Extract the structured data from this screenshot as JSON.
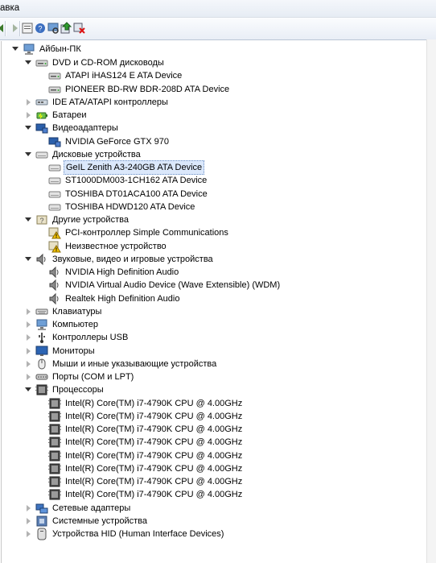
{
  "menubar": {
    "visible_label": "авка"
  },
  "toolbar": {
    "buttons": [
      {
        "name": "back-icon"
      },
      {
        "name": "forward-icon"
      },
      {
        "name": "properties-icon"
      },
      {
        "name": "help-icon"
      },
      {
        "name": "scan-hardware-icon"
      },
      {
        "name": "update-driver-icon"
      },
      {
        "name": "uninstall-icon"
      }
    ]
  },
  "tree": {
    "root": "Айбын-ПК",
    "nodes": [
      {
        "label": "DVD и CD-ROM дисководы",
        "level": 1,
        "state": "open",
        "icon": "dvd-drive-icon"
      },
      {
        "label": "ATAPI iHAS124   E ATA Device",
        "level": 2,
        "icon": "dvd-drive-icon"
      },
      {
        "label": "PIONEER BD-RW   BDR-208D ATA Device",
        "level": 2,
        "icon": "dvd-drive-icon"
      },
      {
        "label": "IDE ATA/ATAPI контроллеры",
        "level": 1,
        "state": "closed",
        "icon": "ide-controller-icon"
      },
      {
        "label": "Батареи",
        "level": 1,
        "state": "closed",
        "icon": "battery-icon"
      },
      {
        "label": "Видеоадаптеры",
        "level": 1,
        "state": "open",
        "icon": "display-adapter-icon"
      },
      {
        "label": "NVIDIA GeForce GTX 970",
        "level": 2,
        "icon": "display-adapter-icon"
      },
      {
        "label": "Дисковые устройства",
        "level": 1,
        "state": "open",
        "icon": "disk-drive-icon"
      },
      {
        "label": "GeIL Zenith A3-240GB ATA Device",
        "level": 2,
        "icon": "disk-drive-icon",
        "selected": true
      },
      {
        "label": "ST1000DM003-1CH162 ATA Device",
        "level": 2,
        "icon": "disk-drive-icon"
      },
      {
        "label": "TOSHIBA DT01ACA100 ATA Device",
        "level": 2,
        "icon": "disk-drive-icon"
      },
      {
        "label": "TOSHIBA HDWD120 ATA Device",
        "level": 2,
        "icon": "disk-drive-icon"
      },
      {
        "label": "Другие устройства",
        "level": 1,
        "state": "open",
        "icon": "other-device-icon"
      },
      {
        "label": "PCI-контроллер Simple Communications",
        "level": 2,
        "icon": "unknown-device-warning-icon"
      },
      {
        "label": "Неизвестное устройство",
        "level": 2,
        "icon": "unknown-device-warning-icon"
      },
      {
        "label": "Звуковые, видео и игровые устройства",
        "level": 1,
        "state": "open",
        "icon": "speaker-icon"
      },
      {
        "label": "NVIDIA High Definition Audio",
        "level": 2,
        "icon": "speaker-icon"
      },
      {
        "label": "NVIDIA Virtual Audio Device (Wave Extensible) (WDM)",
        "level": 2,
        "icon": "speaker-icon"
      },
      {
        "label": "Realtek High Definition Audio",
        "level": 2,
        "icon": "speaker-icon"
      },
      {
        "label": "Клавиатуры",
        "level": 1,
        "state": "closed",
        "icon": "keyboard-icon"
      },
      {
        "label": "Компьютер",
        "level": 1,
        "state": "closed",
        "icon": "computer-icon"
      },
      {
        "label": "Контроллеры USB",
        "level": 1,
        "state": "closed",
        "icon": "usb-icon"
      },
      {
        "label": "Мониторы",
        "level": 1,
        "state": "closed",
        "icon": "monitor-icon"
      },
      {
        "label": "Мыши и иные указывающие устройства",
        "level": 1,
        "state": "closed",
        "icon": "mouse-icon"
      },
      {
        "label": "Порты (COM и LPT)",
        "level": 1,
        "state": "closed",
        "icon": "port-icon"
      },
      {
        "label": "Процессоры",
        "level": 1,
        "state": "open",
        "icon": "processor-icon"
      },
      {
        "label": "Intel(R) Core(TM) i7-4790K CPU @ 4.00GHz",
        "level": 2,
        "icon": "processor-icon"
      },
      {
        "label": "Intel(R) Core(TM) i7-4790K CPU @ 4.00GHz",
        "level": 2,
        "icon": "processor-icon"
      },
      {
        "label": "Intel(R) Core(TM) i7-4790K CPU @ 4.00GHz",
        "level": 2,
        "icon": "processor-icon"
      },
      {
        "label": "Intel(R) Core(TM) i7-4790K CPU @ 4.00GHz",
        "level": 2,
        "icon": "processor-icon"
      },
      {
        "label": "Intel(R) Core(TM) i7-4790K CPU @ 4.00GHz",
        "level": 2,
        "icon": "processor-icon"
      },
      {
        "label": "Intel(R) Core(TM) i7-4790K CPU @ 4.00GHz",
        "level": 2,
        "icon": "processor-icon"
      },
      {
        "label": "Intel(R) Core(TM) i7-4790K CPU @ 4.00GHz",
        "level": 2,
        "icon": "processor-icon"
      },
      {
        "label": "Intel(R) Core(TM) i7-4790K CPU @ 4.00GHz",
        "level": 2,
        "icon": "processor-icon"
      },
      {
        "label": "Сетевые адаптеры",
        "level": 1,
        "state": "closed",
        "icon": "network-adapter-icon"
      },
      {
        "label": "Системные устройства",
        "level": 1,
        "state": "closed",
        "icon": "system-device-icon"
      },
      {
        "label": "Устройства HID (Human Interface Devices)",
        "level": 1,
        "state": "closed",
        "icon": "hid-icon"
      }
    ]
  }
}
